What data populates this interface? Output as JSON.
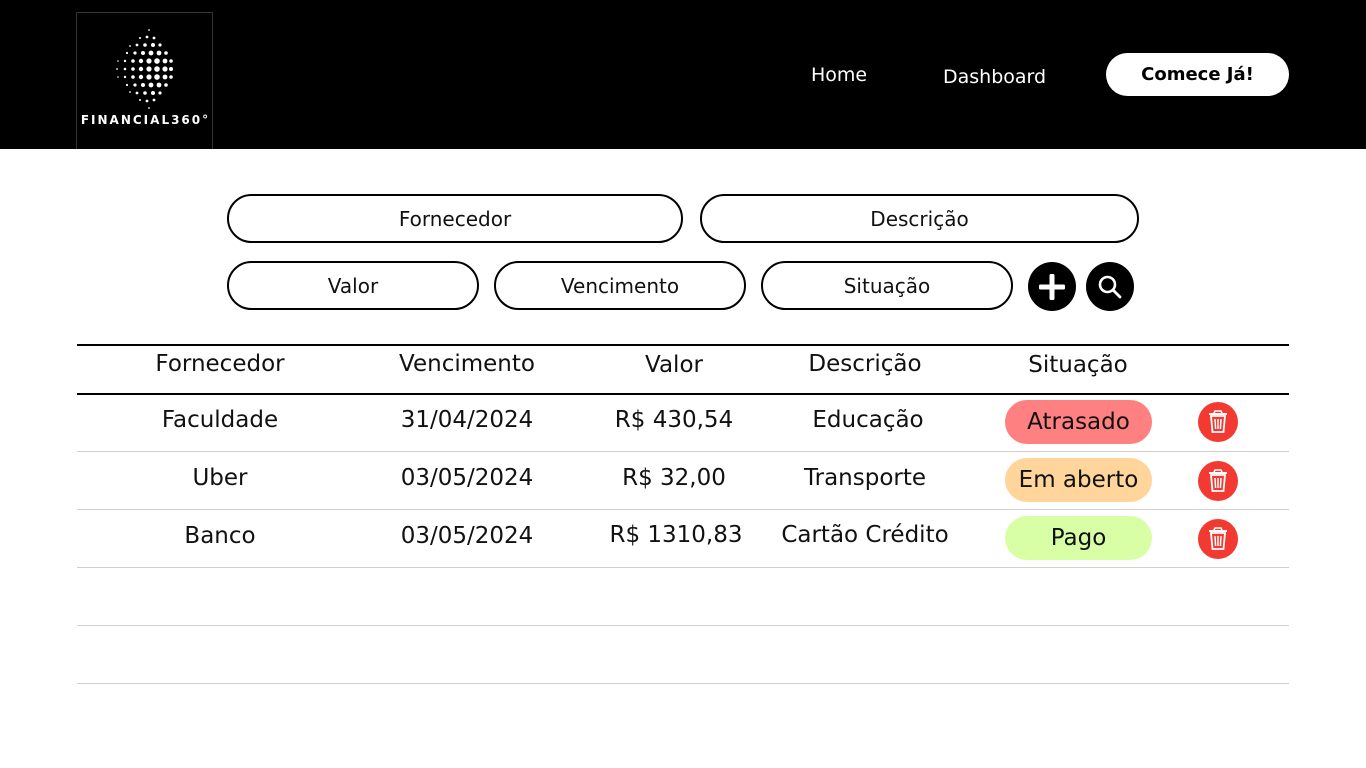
{
  "header": {
    "logo_text": "FINANCIAL360°",
    "nav": [
      {
        "label": "Home"
      },
      {
        "label": "Dashboard"
      }
    ],
    "cta_label": "Comece Já!"
  },
  "filters": {
    "fornecedor": "Fornecedor",
    "descricao": "Descrição",
    "valor": "Valor",
    "vencimento": "Vencimento",
    "situacao": "Situação",
    "add_icon": "plus-icon",
    "search_icon": "search-icon"
  },
  "table": {
    "headers": [
      "Fornecedor",
      "Vencimento",
      "Valor",
      "Descrição",
      "Situação"
    ],
    "rows": [
      {
        "fornecedor": "Faculdade",
        "vencimento": "31/04/2024",
        "valor": "R$ 430,54",
        "descricao": "Educação",
        "situacao": "Atrasado",
        "status_color": "#ff8080"
      },
      {
        "fornecedor": "Uber",
        "vencimento": "03/05/2024",
        "valor": "R$ 32,00",
        "descricao": "Transporte",
        "situacao": "Em aberto",
        "status_color": "#ffd59b"
      },
      {
        "fornecedor": "Banco",
        "vencimento": "03/05/2024",
        "valor": "R$ 1310,83",
        "descricao": "Cartão Crédito",
        "situacao": "Pago",
        "status_color": "#d8ffa6"
      }
    ],
    "delete_icon": "trash-icon",
    "delete_color": "#f23a32"
  }
}
